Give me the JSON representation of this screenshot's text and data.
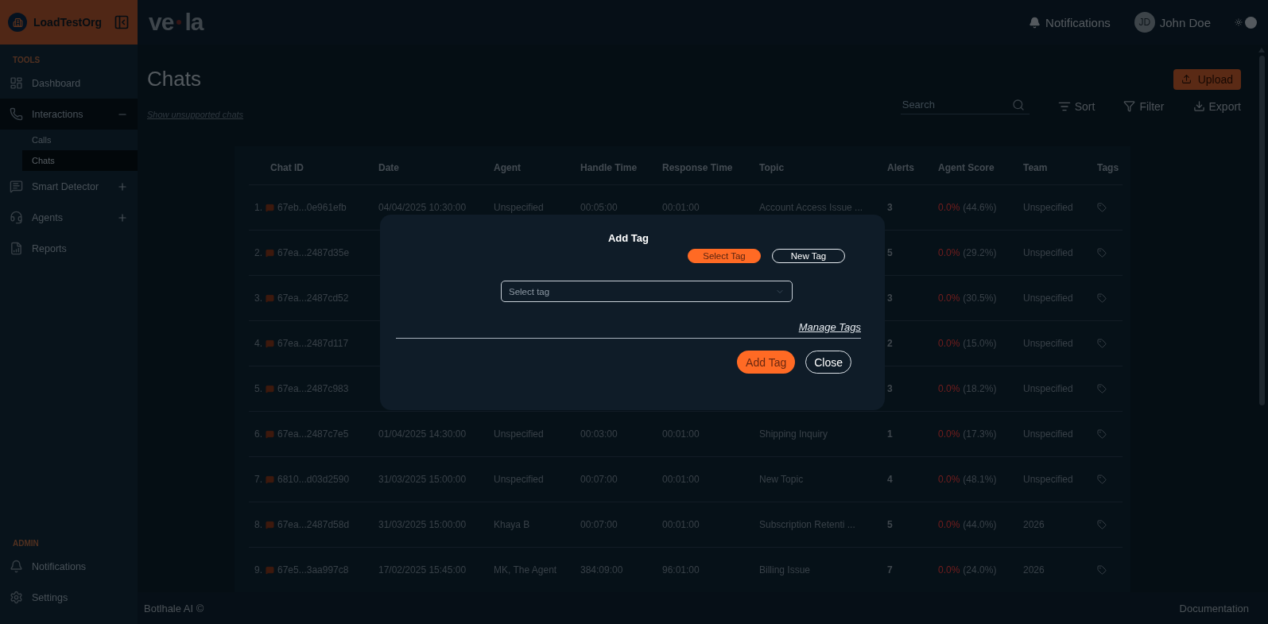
{
  "org": {
    "name": "LoadTestOrg"
  },
  "logo": {
    "left": "ve",
    "right": "la"
  },
  "header": {
    "notifications": "Notifications",
    "avatar": "JD",
    "user": "John Doe",
    "theme_dark": true
  },
  "sidebar": {
    "sections": [
      {
        "title": "TOOLS",
        "items": [
          {
            "label": "Dashboard"
          },
          {
            "label": "Interactions",
            "expanded": true,
            "children": [
              {
                "label": "Calls",
                "selected": false
              },
              {
                "label": "Chats",
                "selected": true
              }
            ]
          },
          {
            "label": "Smart Detector",
            "expanded": false
          },
          {
            "label": "Agents",
            "expanded": false
          },
          {
            "label": "Reports"
          }
        ]
      },
      {
        "title": "ADMIN",
        "items": [
          {
            "label": "Notifications"
          },
          {
            "label": "Settings"
          }
        ]
      }
    ]
  },
  "page": {
    "title": "Chats",
    "upload": "Upload",
    "search_placeholder": "Search",
    "sort": "Sort",
    "filter": "Filter",
    "export": "Export",
    "unsupported_link": "Show unsupported chats"
  },
  "table": {
    "columns": [
      "Chat ID",
      "Date",
      "Agent",
      "Handle Time",
      "Response Time",
      "Topic",
      "Alerts",
      "Agent Score",
      "Team",
      "Tags"
    ],
    "rows": [
      {
        "index": "1.",
        "chat_id": "67eb...0e961efb",
        "date": "04/04/2025 10:30:00",
        "agent": "Unspecified",
        "handle_time": "00:05:00",
        "response_time": "00:01:00",
        "topic": "Account Access Issue ...",
        "alerts": "3",
        "score": "0.0%",
        "score_pct": "(44.6%)",
        "team": "Unspecified"
      },
      {
        "index": "2.",
        "chat_id": "67ea...2487d35e",
        "alerts": "5",
        "score": "0.0%",
        "score_pct": "(29.2%)",
        "team": "Unspecified"
      },
      {
        "index": "3.",
        "chat_id": "67ea...2487cd52",
        "alerts": "3",
        "score": "0.0%",
        "score_pct": "(30.5%)",
        "team": "Unspecified"
      },
      {
        "index": "4.",
        "chat_id": "67ea...2487d117",
        "alerts": "2",
        "score": "0.0%",
        "score_pct": "(15.0%)",
        "team": "Unspecified"
      },
      {
        "index": "5.",
        "chat_id": "67ea...2487c983",
        "alerts": "3",
        "score": "0.0%",
        "score_pct": "(18.2%)",
        "team": "Unspecified"
      },
      {
        "index": "6.",
        "chat_id": "67ea...2487c7e5",
        "date": "01/04/2025 14:30:00",
        "agent": "Unspecified",
        "handle_time": "00:03:00",
        "response_time": "00:01:00",
        "topic": "Shipping Inquiry",
        "alerts": "1",
        "score": "0.0%",
        "score_pct": "(17.3%)",
        "team": "Unspecified"
      },
      {
        "index": "7.",
        "chat_id": "6810...d03d2590",
        "date": "31/03/2025 15:00:00",
        "agent": "Unspecified",
        "handle_time": "00:07:00",
        "response_time": "00:01:00",
        "topic": "New Topic",
        "alerts": "4",
        "score": "0.0%",
        "score_pct": "(48.1%)",
        "team": "Unspecified"
      },
      {
        "index": "8.",
        "chat_id": "67ea...2487d58d",
        "date": "31/03/2025 15:00:00",
        "agent": "Khaya B",
        "handle_time": "00:07:00",
        "response_time": "00:01:00",
        "topic": "Subscription Retenti ...",
        "alerts": "5",
        "score": "0.0%",
        "score_pct": "(44.0%)",
        "team": "2026"
      },
      {
        "index": "9.",
        "chat_id": "67e5...3aa997c8",
        "date": "17/02/2025 15:45:00",
        "agent": "MK, The Agent",
        "handle_time": "384:09:00",
        "response_time": "96:01:00",
        "topic": "Billing Issue",
        "alerts": "7",
        "score": "0.0%",
        "score_pct": "(24.0%)",
        "team": "2026"
      }
    ]
  },
  "footer": {
    "brand": "Botlhale AI ©",
    "docs": "Documentation"
  },
  "modal": {
    "title": "Add Tag",
    "modes": [
      {
        "label": "Select Tag",
        "selected": true
      },
      {
        "label": "New Tag",
        "selected": false
      }
    ],
    "select_placeholder": "Select tag",
    "manage_link": "Manage Tags",
    "primary": "Add Tag",
    "secondary": "Close"
  }
}
